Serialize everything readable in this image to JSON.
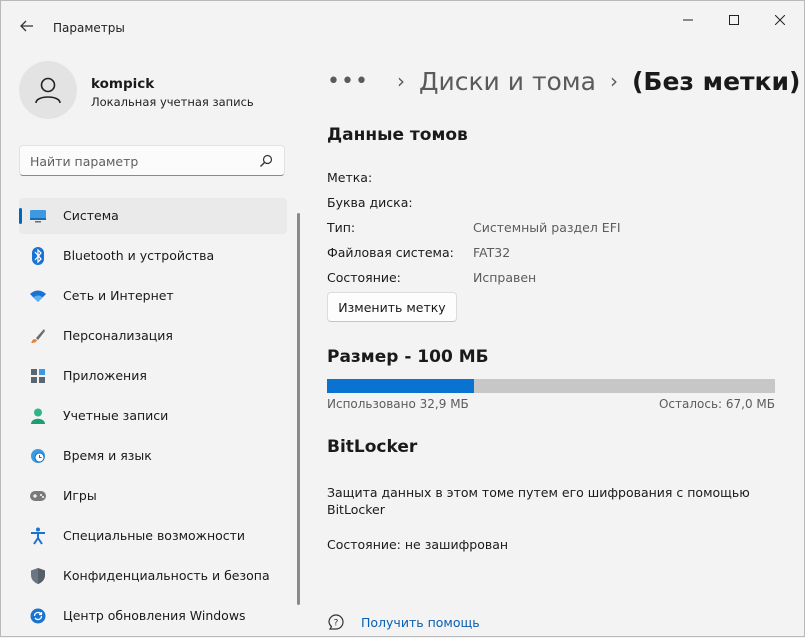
{
  "window": {
    "title": "Параметры"
  },
  "user": {
    "name": "kompick",
    "account_type": "Локальная учетная запись"
  },
  "search": {
    "placeholder": "Найти параметр"
  },
  "sidebar": {
    "items": [
      {
        "label": "Система",
        "icon": "system-icon",
        "active": true
      },
      {
        "label": "Bluetooth и устройства",
        "icon": "bluetooth-icon"
      },
      {
        "label": "Сеть и Интернет",
        "icon": "wifi-icon"
      },
      {
        "label": "Персонализация",
        "icon": "brush-icon"
      },
      {
        "label": "Приложения",
        "icon": "apps-icon"
      },
      {
        "label": "Учетные записи",
        "icon": "accounts-icon"
      },
      {
        "label": "Время и язык",
        "icon": "time-language-icon"
      },
      {
        "label": "Игры",
        "icon": "gamepad-icon"
      },
      {
        "label": "Специальные возможности",
        "icon": "accessibility-icon"
      },
      {
        "label": "Конфиденциальность и безопасность",
        "icon": "shield-icon"
      },
      {
        "label": "Центр обновления Windows",
        "icon": "update-icon"
      }
    ]
  },
  "breadcrumb": {
    "more": "•••",
    "parent": "Диски и тома",
    "current": "(Без метки)"
  },
  "volume": {
    "heading": "Данные томов",
    "properties": [
      {
        "label": "Метка:",
        "value": ""
      },
      {
        "label": "Буква диска:",
        "value": ""
      },
      {
        "label": "Тип:",
        "value": "Системный раздел EFI"
      },
      {
        "label": "Файловая система:",
        "value": "FAT32"
      },
      {
        "label": "Состояние:",
        "value": "Исправен"
      }
    ],
    "change_label_button": "Изменить метку"
  },
  "size": {
    "heading": "Размер - 100 МБ",
    "used_fraction": 0.329,
    "used_label": "Использовано 32,9 МБ",
    "free_label": "Осталось: 67,0 МБ"
  },
  "bitlocker": {
    "heading": "BitLocker",
    "description": "Защита данных в этом томе путем его шифрования с помощью BitLocker",
    "status": "Состояние: не зашифрован"
  },
  "help": {
    "label": "Получить помощь"
  },
  "colors": {
    "accent": "#0067c0",
    "bar_used": "#0a73d1",
    "bar_free": "#c7c7c7",
    "link": "#0a5eb0"
  }
}
